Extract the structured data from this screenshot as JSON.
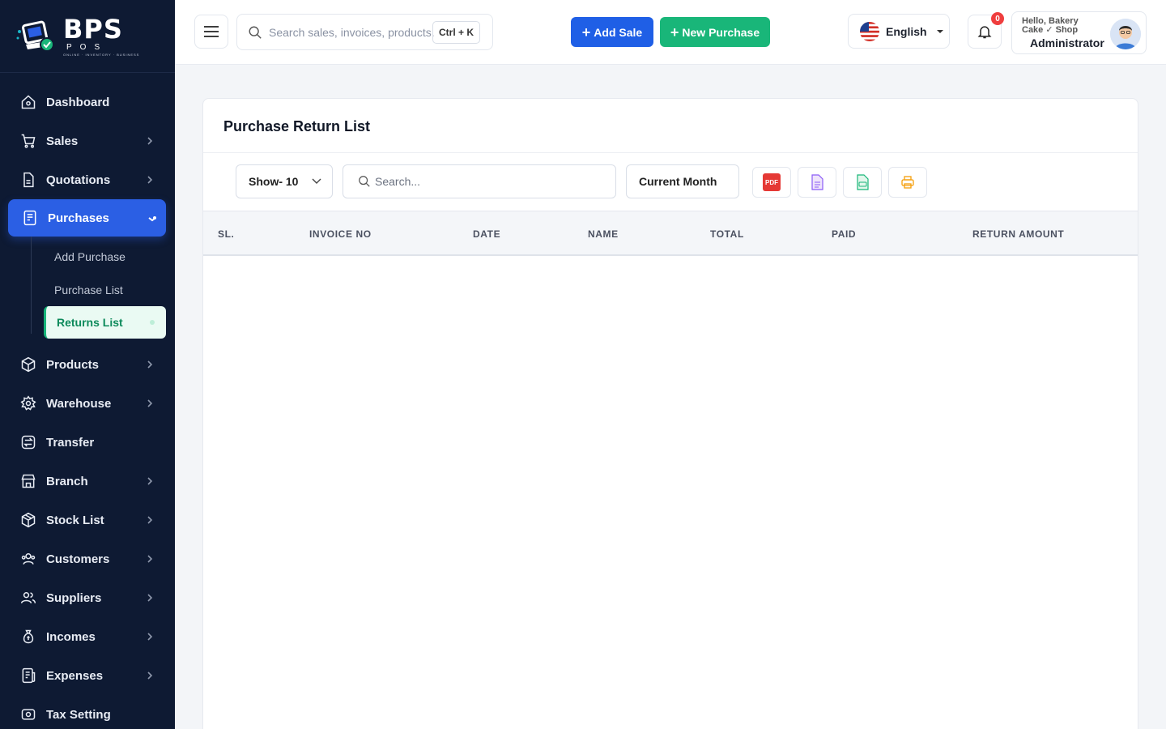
{
  "brand": {
    "name": "BPS",
    "sub": "POS",
    "tagline": "ONLINE · INVENTORY · BUSINESS"
  },
  "sidebar": {
    "items": [
      {
        "label": "Dashboard"
      },
      {
        "label": "Sales"
      },
      {
        "label": "Quotations"
      },
      {
        "label": "Purchases"
      },
      {
        "label": "Products"
      },
      {
        "label": "Warehouse"
      },
      {
        "label": "Transfer"
      },
      {
        "label": "Branch"
      },
      {
        "label": "Stock List"
      },
      {
        "label": "Customers"
      },
      {
        "label": "Suppliers"
      },
      {
        "label": "Incomes"
      },
      {
        "label": "Expenses"
      },
      {
        "label": "Tax Setting"
      }
    ],
    "purchases_sub": [
      {
        "label": "Add Purchase"
      },
      {
        "label": "Purchase List"
      },
      {
        "label": "Returns List"
      }
    ]
  },
  "header": {
    "search_placeholder": "Search sales, invoices, products...",
    "shortcut": "Ctrl + K",
    "add_sale": "Add Sale",
    "new_purchase": "New Purchase",
    "language": "English",
    "notifications": "0",
    "greeting": "Hello, Bakery Cake ✓ Shop",
    "role": "Administrator"
  },
  "page": {
    "title": "Purchase Return List",
    "show": "Show- 10",
    "search_placeholder": "Search...",
    "period": "Current Month",
    "pdf_label": "PDF",
    "columns": [
      "SL.",
      "INVOICE NO",
      "DATE",
      "NAME",
      "TOTAL",
      "PAID",
      "RETURN AMOUNT"
    ]
  },
  "colors": {
    "sidebar": "#0e1a33",
    "primary": "#1f5fe6",
    "success": "#19b679",
    "danger": "#ef3e3e"
  }
}
